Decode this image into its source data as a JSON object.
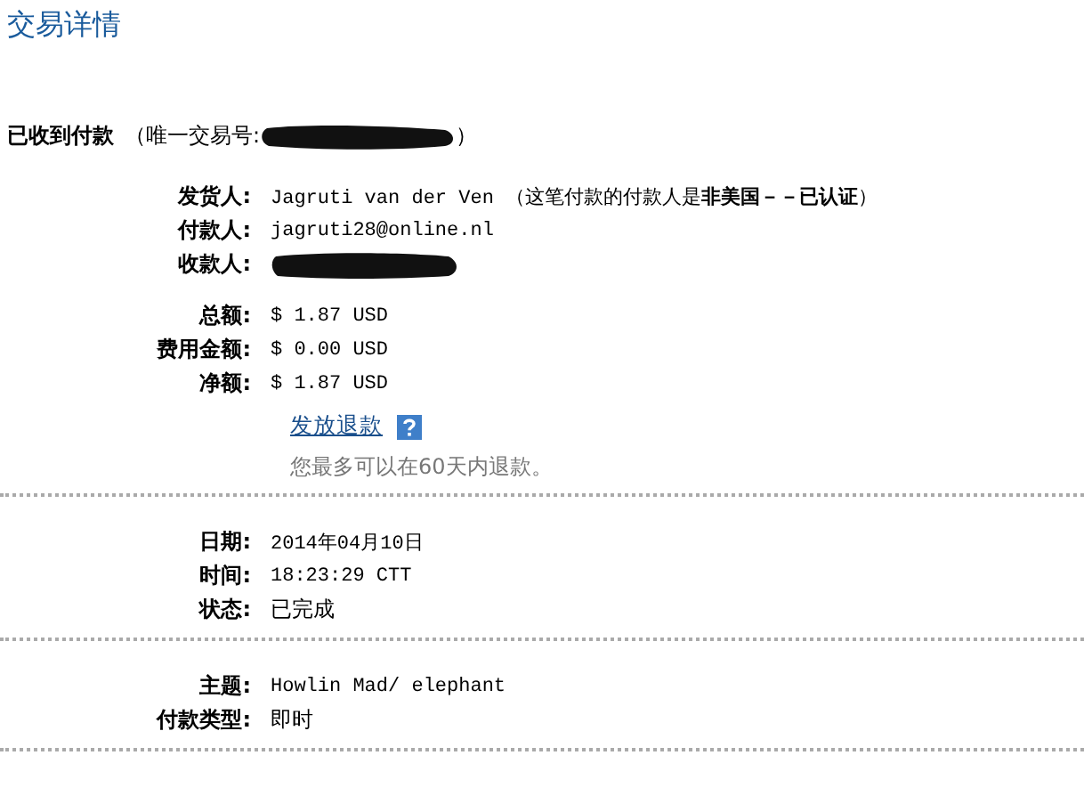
{
  "title": "交易详情",
  "received": {
    "label": "已收到付款",
    "id_prefix": "（唯一交易号:",
    "id_suffix": "）"
  },
  "sections": [
    {
      "groups": [
        {
          "rows": [
            {
              "label": "发货人:",
              "kind": "mono",
              "value": "Jagruti van der Ven （这笔付款的付款人是**非美国－－已认证**）"
            },
            {
              "label": "付款人:",
              "kind": "mono",
              "value": "jagruti28@online.nl"
            },
            {
              "label": "收款人:",
              "kind": "redacted"
            }
          ]
        },
        {
          "rows": [
            {
              "label": "总额:",
              "kind": "mono",
              "value": "$ 1.87 USD"
            },
            {
              "label": "费用金额:",
              "kind": "mono",
              "value": "$ 0.00 USD"
            },
            {
              "label": "净额:",
              "kind": "mono",
              "value": "$ 1.87 USD"
            }
          ],
          "refund": {
            "link": "发放退款",
            "note": "您最多可以在60天内退款。"
          }
        }
      ]
    },
    {
      "groups": [
        {
          "rows": [
            {
              "label": "日期:",
              "kind": "mono",
              "value": "2014年04月10日"
            },
            {
              "label": "时间:",
              "kind": "mono",
              "value": "18:23:29 CTT"
            },
            {
              "label": "状态:",
              "kind": "plain",
              "value": "已完成"
            }
          ]
        }
      ]
    },
    {
      "groups": [
        {
          "rows": [
            {
              "label": "主题:",
              "kind": "mono",
              "value": "Howlin Mad/ elephant"
            },
            {
              "label": "付款类型:",
              "kind": "plain",
              "value": "即时"
            }
          ]
        }
      ]
    }
  ]
}
